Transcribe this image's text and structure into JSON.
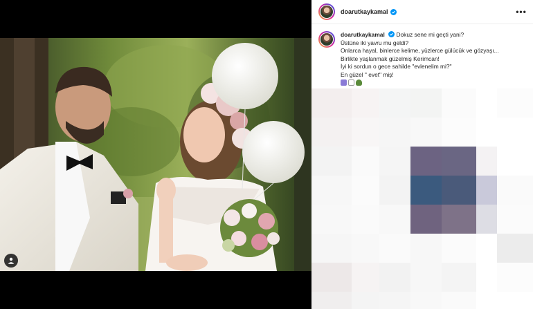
{
  "post": {
    "username": "doarutkaykamal",
    "more_label": "•••"
  },
  "caption": {
    "username": "doarutkaykamal",
    "lines": [
      "Dokuz sene mi geçti yani?",
      "Üstüne iki yavru mu geldi?",
      "Onlarca hayal, binlerce kelime, yüzlerce gülücük ve gözyaşı...",
      "Birlikte yaşlanmak güzelmiş Kerimcan!",
      "İyi ki sordun o gece sahilde \"evlenelim mi?\"",
      "En güzel \" evet\" miş!"
    ]
  },
  "icons": {
    "tag": "user-tag-icon",
    "verified": "verified-badge-icon",
    "more": "more-options-icon"
  },
  "colors": {
    "verified": "#0095f6",
    "text": "#262626"
  }
}
